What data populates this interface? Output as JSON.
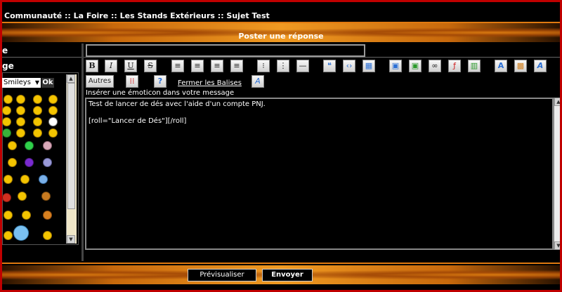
{
  "breadcrumb": {
    "text": "Communauté :: La Foire :: Les Stands Extérieurs :: Sujet Test"
  },
  "header": {
    "title": "Poster une réponse"
  },
  "labels": {
    "subject_label": "e",
    "message_label": "ge"
  },
  "smileys": {
    "select_value": "Smileys",
    "ok_label": "Ok"
  },
  "toolbar": {
    "bold": "B",
    "italic": "I",
    "underline": "U",
    "strike": "S",
    "autres": "Autres",
    "fermer": "Fermer les Balises",
    "font_size_label": "A"
  },
  "hint": "Insérer une émoticon dans votre message",
  "message": {
    "line1": "Test de lancer de dés avec l'aide d'un compte PNJ.",
    "line2": "",
    "line3": "[roll=\"Lancer de Dés\"][/roll]"
  },
  "footer": {
    "preview_label": "Prévisualiser",
    "send_label": "Envoyer"
  },
  "colors": {
    "frame": "#c00000",
    "accent": "#e07a10",
    "smiley": "#f3c400"
  }
}
